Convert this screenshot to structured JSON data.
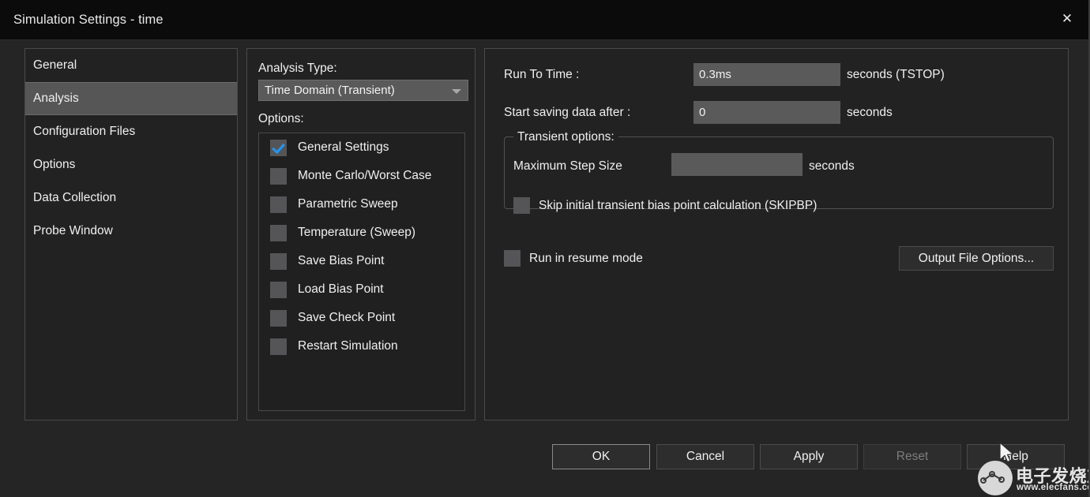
{
  "window": {
    "title": "Simulation Settings - time",
    "close_icon": "close-icon",
    "close_glyph": "✕"
  },
  "sidebar": {
    "items": [
      {
        "label": "General",
        "selected": false
      },
      {
        "label": "Analysis",
        "selected": true
      },
      {
        "label": "Configuration Files",
        "selected": false
      },
      {
        "label": "Options",
        "selected": false
      },
      {
        "label": "Data Collection",
        "selected": false
      },
      {
        "label": "Probe Window",
        "selected": false
      }
    ]
  },
  "analysis": {
    "type_label": "Analysis Type:",
    "type_value": "Time Domain (Transient)",
    "type_arrow_icon": "chevron-down-icon",
    "options_label": "Options:",
    "options": [
      {
        "label": "General Settings",
        "checked": true
      },
      {
        "label": "Monte Carlo/Worst Case",
        "checked": false
      },
      {
        "label": "Parametric Sweep",
        "checked": false
      },
      {
        "label": "Temperature (Sweep)",
        "checked": false
      },
      {
        "label": "Save Bias Point",
        "checked": false
      },
      {
        "label": "Load Bias Point",
        "checked": false
      },
      {
        "label": "Save Check Point",
        "checked": false
      },
      {
        "label": "Restart Simulation",
        "checked": false
      }
    ]
  },
  "content": {
    "run_to_time_label": "Run To Time :",
    "run_to_time_value": "0.3ms",
    "run_to_time_placeholder": "",
    "run_to_time_unit": "seconds (TSTOP)",
    "start_saving_label": "Start saving data after :",
    "start_saving_value": "0",
    "start_saving_placeholder": "",
    "start_saving_unit": "seconds",
    "transient_legend": "Transient options:",
    "max_step_label": "Maximum Step Size",
    "max_step_value": "",
    "max_step_placeholder": "",
    "max_step_unit": "seconds",
    "skipbp_label": "Skip initial transient bias point calculation (SKIPBP)",
    "skipbp_checked": false,
    "resume_label": "Run in resume mode",
    "resume_checked": false,
    "output_file_options_label": "Output File Options..."
  },
  "footer": {
    "ok_label": "OK",
    "cancel_label": "Cancel",
    "apply_label": "Apply",
    "reset_label": "Reset",
    "reset_disabled": true,
    "help_label": "Help"
  },
  "watermark": {
    "cn_text": "电子发烧友",
    "url_text": "www.elecfans.com",
    "logo_icon": "network-nodes-logo-icon"
  },
  "colors": {
    "window_bg": "#252526",
    "titlebar_bg": "#0b0b0b",
    "panel_border": "#4a4a4a",
    "selection_bg": "#565656",
    "input_bg": "#5a5a5a",
    "check_accent": "#2196f3",
    "text": "#f0f0f0",
    "disabled_text": "#7d7d7d"
  }
}
